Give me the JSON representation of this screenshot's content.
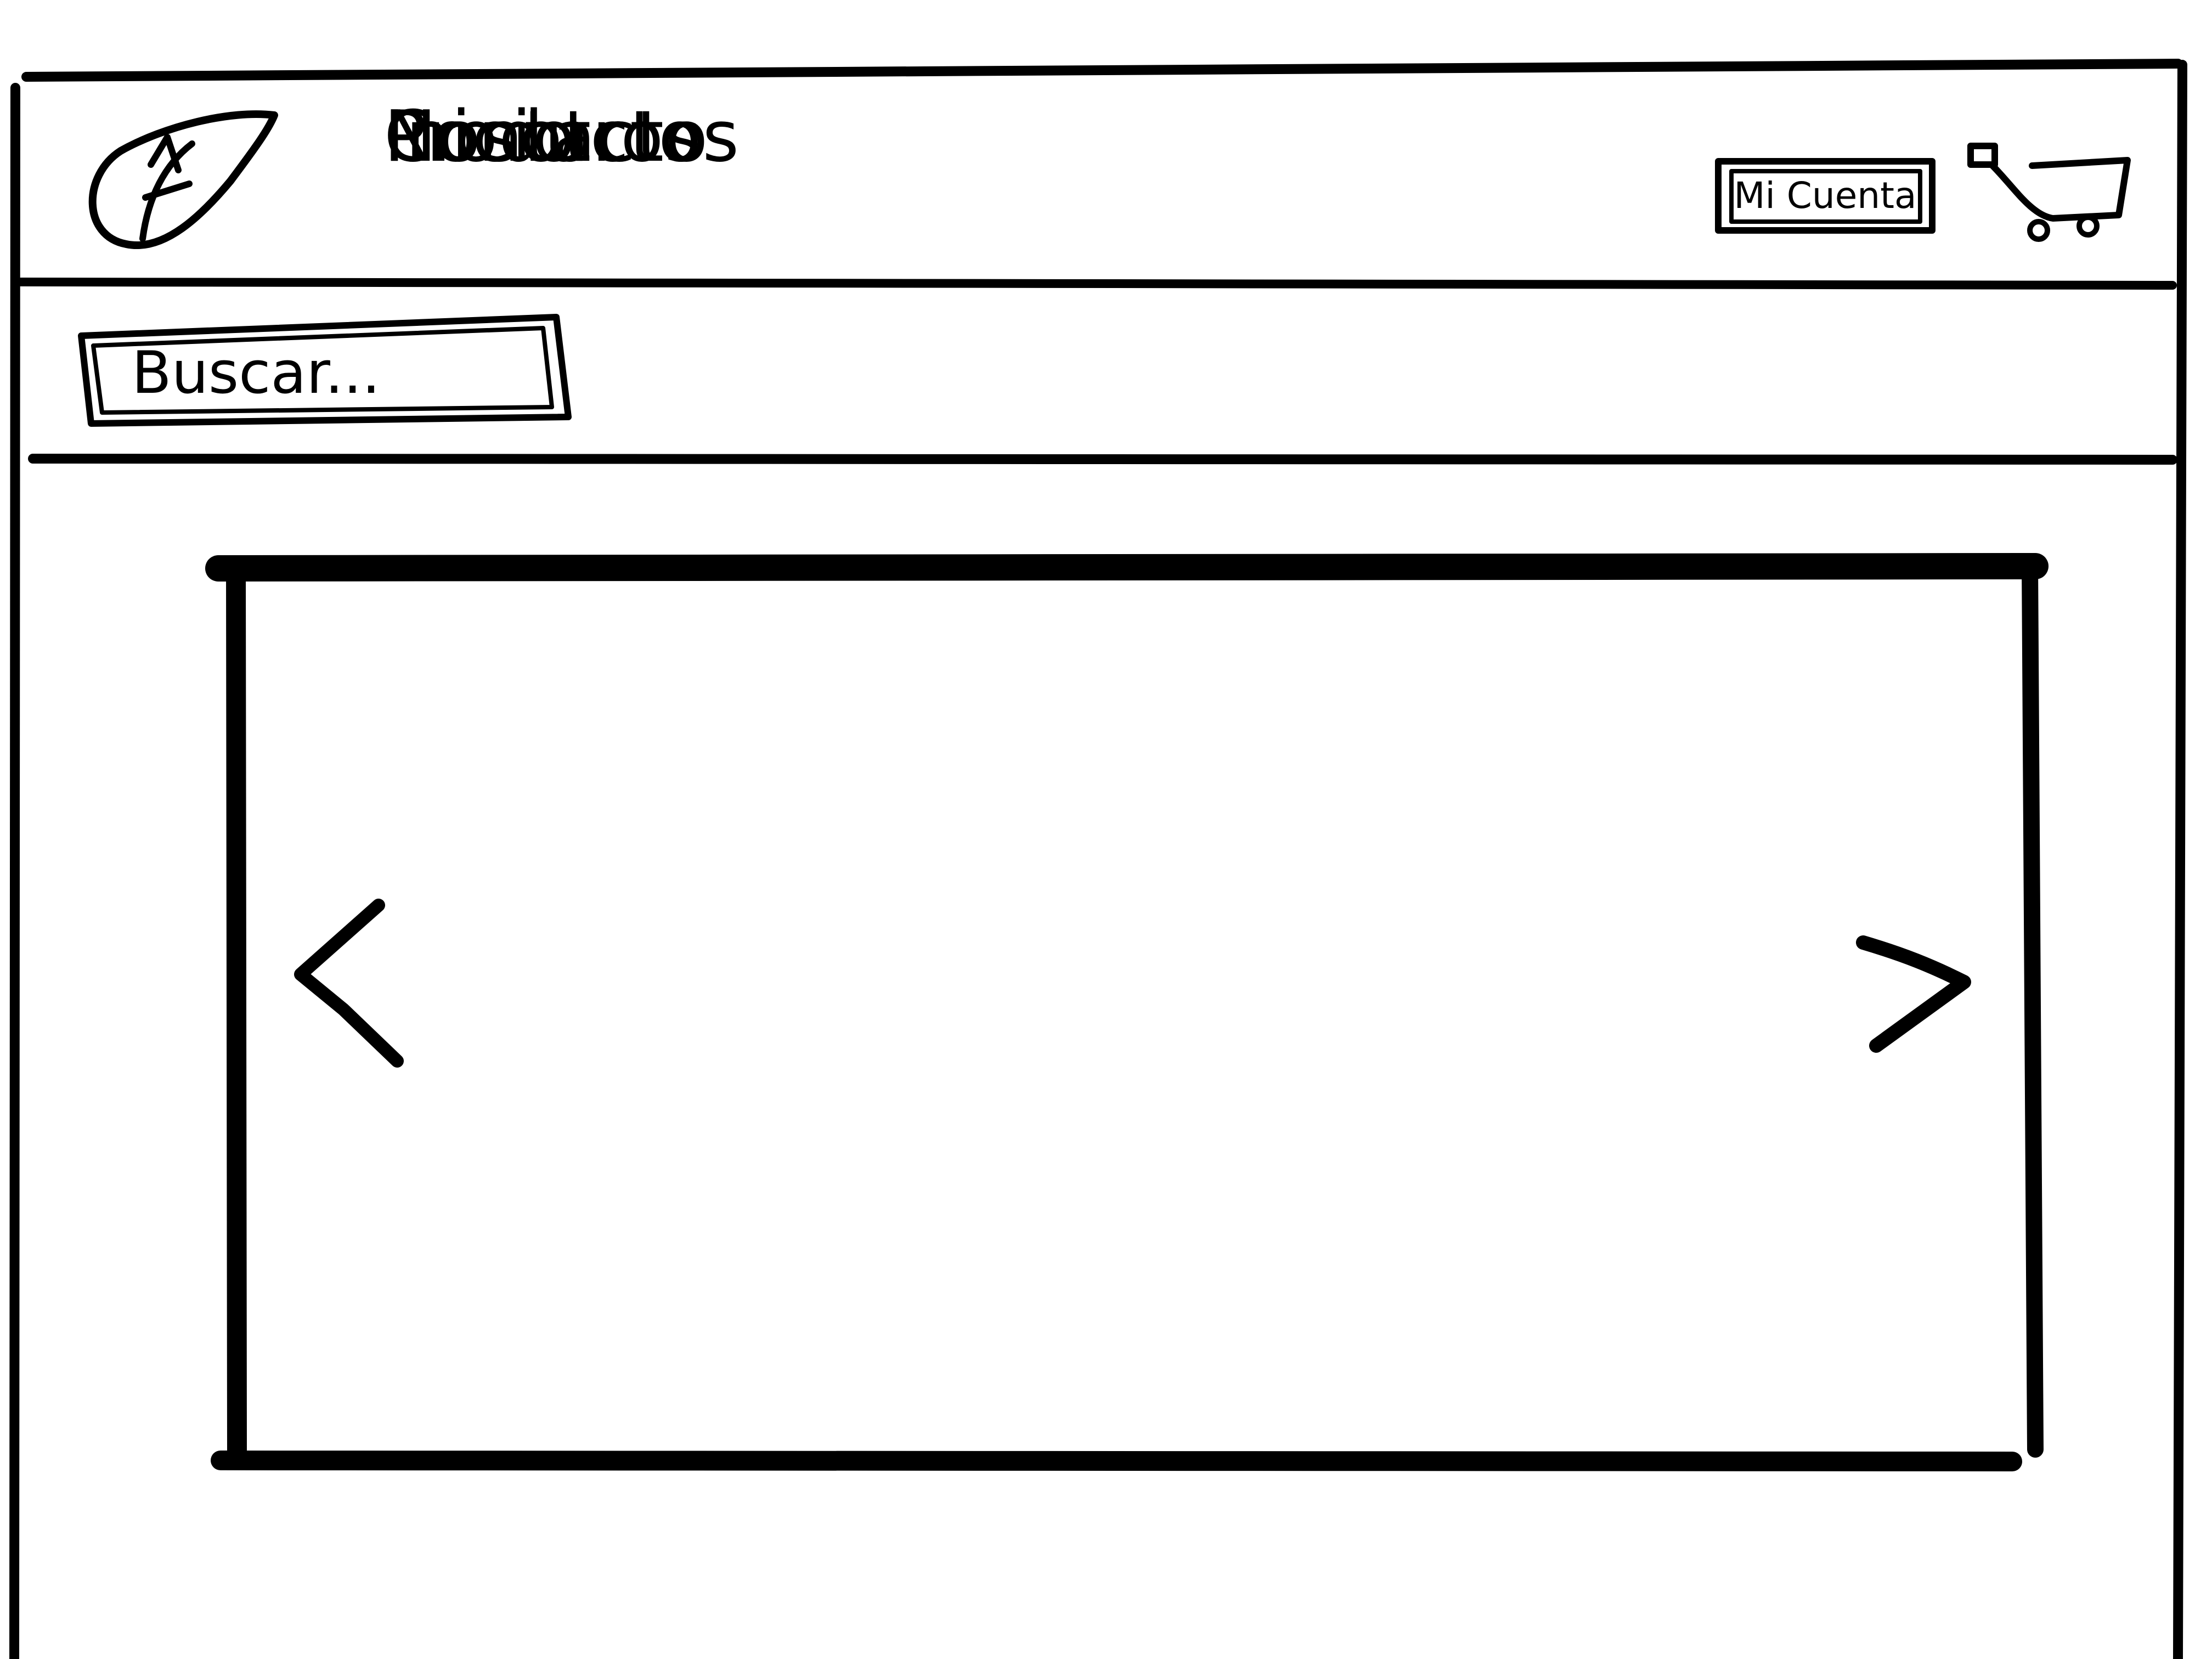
{
  "header": {
    "logo": "leaf-logo",
    "nav": [
      {
        "label": "Inicio"
      },
      {
        "label": "Productos"
      },
      {
        "label": "Nosotros"
      },
      {
        "label": "Contacto"
      }
    ],
    "account_label": "Mi Cuenta",
    "cart_icon": "cart-icon"
  },
  "search": {
    "placeholder": "Buscar..."
  },
  "carousel": {
    "prev_icon": "chevron-left-icon",
    "next_icon": "chevron-right-icon"
  }
}
